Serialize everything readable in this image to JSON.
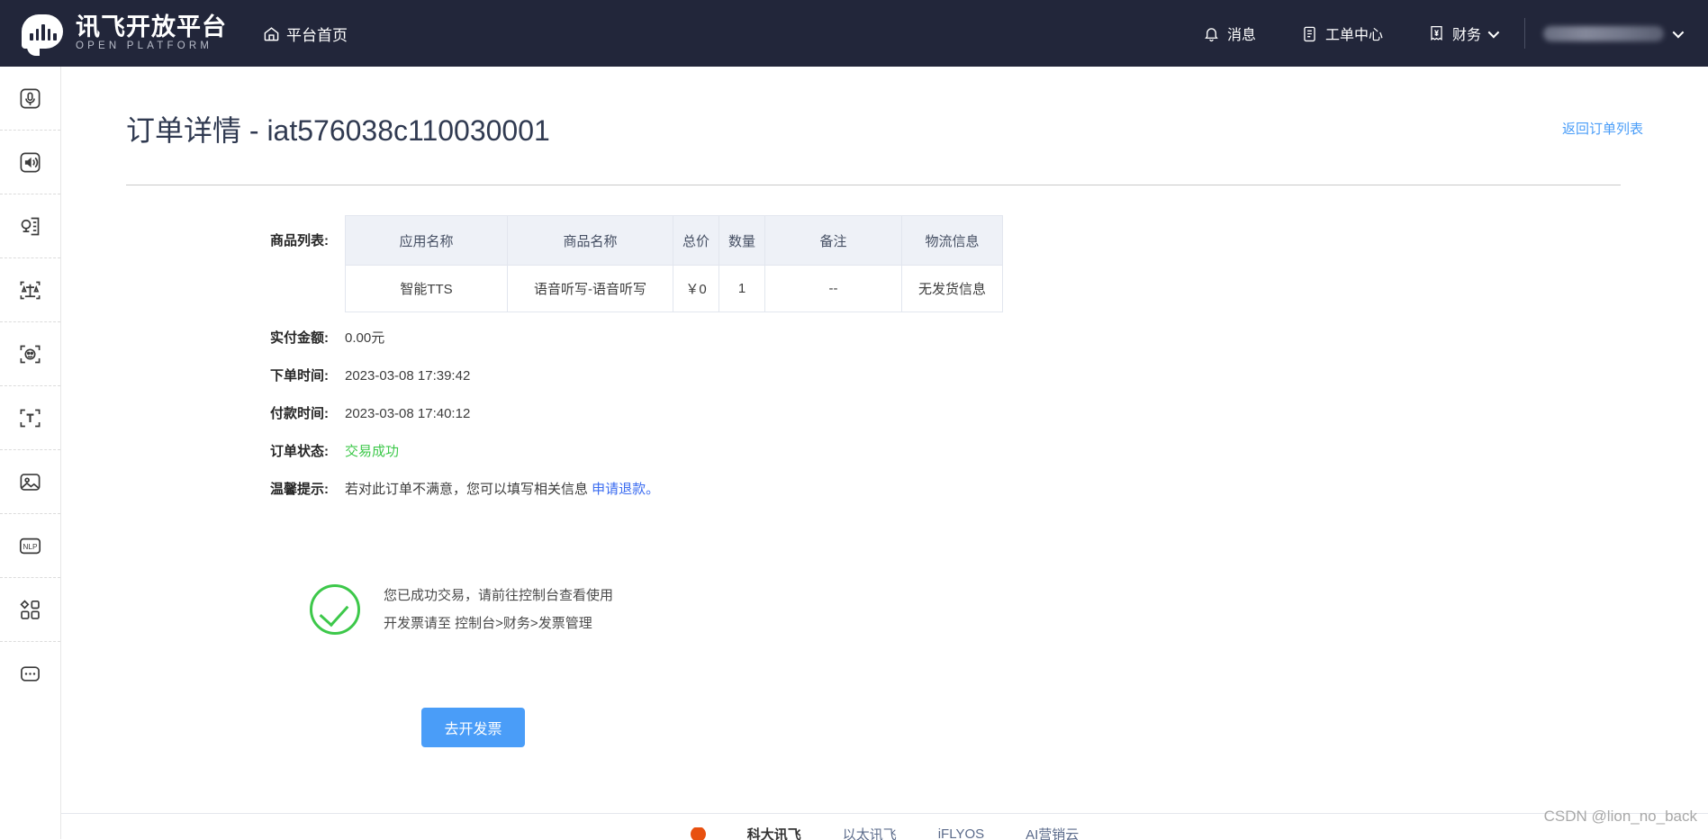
{
  "topnav": {
    "brand": {
      "cn": "讯飞开放平台",
      "en": "OPEN PLATFORM",
      "logo_icon": "speech-bubble-logo"
    },
    "home": {
      "label": "平台首页",
      "icon": "home-icon"
    },
    "items": [
      {
        "label": "消息",
        "icon": "bell-icon"
      },
      {
        "label": "工单中心",
        "icon": "clipboard-icon"
      },
      {
        "label": "财务",
        "icon": "invoice-yen-icon",
        "has_dropdown": true
      }
    ],
    "user": {
      "name_redacted": true,
      "has_dropdown": true
    }
  },
  "sidebar": {
    "items": [
      {
        "name": "speech-recognition",
        "icon": "mic-frame-icon"
      },
      {
        "name": "speech-synthesis",
        "icon": "speaker-frame-icon"
      },
      {
        "name": "voice-transcription",
        "icon": "mic-document-icon"
      },
      {
        "name": "voice-evaluation",
        "icon": "scales-frame-icon"
      },
      {
        "name": "face-recognition",
        "icon": "face-scan-icon"
      },
      {
        "name": "text-recognition",
        "icon": "ocr-t-icon"
      },
      {
        "name": "image-recognition",
        "icon": "picture-icon"
      },
      {
        "name": "nlp",
        "icon": "nlp-icon"
      },
      {
        "name": "all-apps",
        "icon": "apps-grid-icon"
      },
      {
        "name": "more",
        "icon": "ellipsis-icon"
      }
    ]
  },
  "page": {
    "title": "订单详情 - iat576038c110030001",
    "back_link": "返回订单列表"
  },
  "order": {
    "goods_label": "商品列表:",
    "table": {
      "headers": [
        "应用名称",
        "商品名称",
        "总价",
        "数量",
        "备注",
        "物流信息"
      ],
      "rows": [
        [
          "智能TTS",
          "语音听写-语音听写",
          "￥0",
          "1",
          "--",
          "无发货信息"
        ]
      ]
    },
    "fields": [
      {
        "label": "实付金额:",
        "value": "0.00元"
      },
      {
        "label": "下单时间:",
        "value": "2023-03-08 17:39:42"
      },
      {
        "label": "付款时间:",
        "value": "2023-03-08 17:40:12"
      },
      {
        "label": "订单状态:",
        "value": "交易成功"
      }
    ],
    "status_color": "#3dc84a",
    "tip": {
      "label": "温馨提示:",
      "text": "若对此订单不满意，您可以填写相关信息 ",
      "link": "申请退款。"
    }
  },
  "success": {
    "icon": "check-circle-icon",
    "line1": "您已成功交易，请前往控制台查看使用",
    "line2": "开发票请至 控制台>财务>发票管理",
    "button": "去开发票"
  },
  "footer": {
    "brand": "科大讯飞",
    "links": [
      "以太讯飞",
      "iFLYOS",
      "AI营销云"
    ],
    "watermark": "CSDN @lion_no_back"
  }
}
